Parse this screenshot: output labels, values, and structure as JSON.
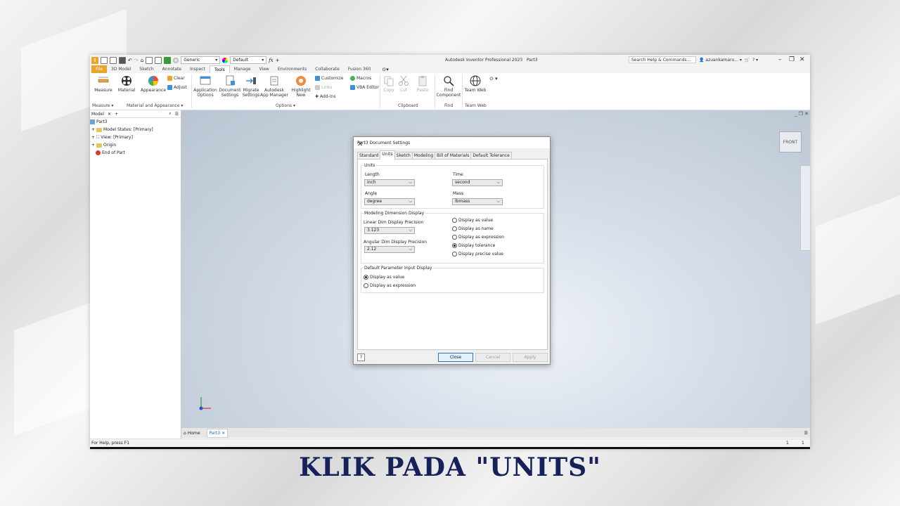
{
  "window": {
    "app_title": "Autodesk Inventor Professional 2023",
    "doc_name": "Part3",
    "search_placeholder": "Search Help & Commands...",
    "user": "azuankamaru...",
    "appearance_combo": "Generic",
    "style_combo": "Default",
    "qat_logo": "I"
  },
  "ribbon": {
    "tabs": [
      "File",
      "3D Model",
      "Sketch",
      "Annotate",
      "Inspect",
      "Tools",
      "Manage",
      "View",
      "Environments",
      "Collaborate",
      "Fusion 360"
    ],
    "active_tab": "Tools",
    "buttons": {
      "measure": "Measure",
      "material": "Material",
      "appearance": "Appearance",
      "clear": "Clear",
      "adjust": "Adjust",
      "application_options": [
        "Application",
        "Options"
      ],
      "document_settings": [
        "Document",
        "Settings"
      ],
      "migrate_settings": [
        "Migrate",
        "Settings"
      ],
      "app_manager": [
        "Autodesk",
        "App Manager"
      ],
      "highlight_new": [
        "Highlight",
        "New"
      ],
      "customize": "Customize",
      "links": "Links",
      "add_ins": "Add-Ins",
      "macros": "Macros",
      "vba_editor": "VBA Editor",
      "copy": "Copy",
      "cut": "Cut",
      "paste": "Paste",
      "find_component": [
        "Find",
        "Component"
      ],
      "team_web": "Team Web"
    },
    "panels": {
      "measure": "Measure ▾",
      "material_appearance": "Material and Appearance ▾",
      "options": "Options ▾",
      "clipboard": "Clipboard",
      "find": "Find",
      "team_web": "Team Web"
    }
  },
  "browser": {
    "tab": "Model",
    "items": [
      {
        "label": "Part3"
      },
      {
        "label": "Model States: [Primary]"
      },
      {
        "label": "View: [Primary]"
      },
      {
        "label": "Origin"
      },
      {
        "label": "End of Part"
      }
    ]
  },
  "viewcube": {
    "label": "FRONT"
  },
  "doc_tabs": {
    "home": "Home",
    "part": "Part3"
  },
  "status": {
    "help_text": "For Help, press F1",
    "count1": "1",
    "count2": "1"
  },
  "dialog": {
    "title": "Part3 Document Settings",
    "tabs": [
      "Standard",
      "Units",
      "Sketch",
      "Modeling",
      "Bill of Materials",
      "Default Tolerance"
    ],
    "active_tab": "Units",
    "units_group": {
      "label": "Units",
      "length_label": "Length",
      "length_value": "inch",
      "time_label": "Time",
      "time_value": "second",
      "angle_label": "Angle",
      "angle_value": "degree",
      "mass_label": "Mass",
      "mass_value": "lbmass"
    },
    "dim_group": {
      "label": "Modeling Dimension Display",
      "linear_label": "Linear Dim Display Precision",
      "linear_value": "3.123",
      "angular_label": "Angular Dim Display Precision",
      "angular_value": "2.12",
      "options": [
        "Display as value",
        "Display as name",
        "Display as expression",
        "Display tolerance",
        "Display precise value"
      ],
      "selected": "Display tolerance"
    },
    "param_group": {
      "label": "Default Parameter Input Display",
      "options": [
        "Display as value",
        "Display as expression"
      ],
      "selected": "Display as value"
    },
    "buttons": {
      "close": "Close",
      "cancel": "Cancel",
      "apply": "Apply",
      "help": "?"
    }
  },
  "caption": "KLIK PADA \"UNITS\"",
  "colors": {
    "file_tab": "#e9a62b",
    "caption": "#16215a",
    "accent": "#2a73cc"
  }
}
